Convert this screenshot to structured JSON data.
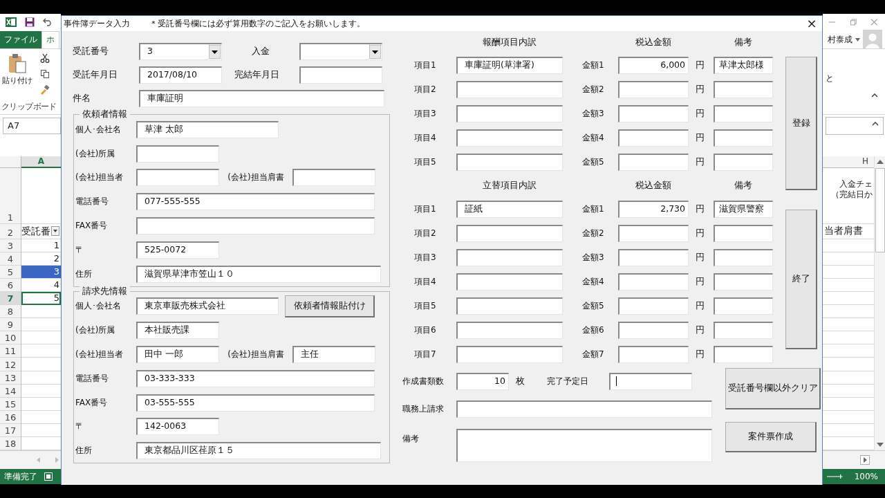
{
  "excel": {
    "file_tab": "ファイル",
    "home_tab": "ホ",
    "paste_label": "貼り付け",
    "group_label": "クリップボード",
    "name_box": "A7",
    "column_left": "A",
    "row1": "1",
    "header_row": {
      "num": "2",
      "cell": "受託番"
    },
    "rows": [
      {
        "num": "3",
        "cell": "1",
        "selected": false,
        "active": false
      },
      {
        "num": "4",
        "cell": "2",
        "selected": false,
        "active": false
      },
      {
        "num": "5",
        "cell": "3",
        "selected": true,
        "active": false
      },
      {
        "num": "6",
        "cell": "4",
        "selected": false,
        "active": false
      },
      {
        "num": "7",
        "cell": "5",
        "selected": false,
        "active": true
      },
      {
        "num": "8",
        "selected": false,
        "active": false
      },
      {
        "num": "9",
        "selected": false,
        "active": false
      },
      {
        "num": "10",
        "selected": false,
        "active": false
      },
      {
        "num": "11",
        "selected": false,
        "active": false
      },
      {
        "num": "12",
        "selected": false,
        "active": false
      },
      {
        "num": "13",
        "selected": false,
        "active": false
      },
      {
        "num": "14",
        "selected": false,
        "active": false
      },
      {
        "num": "15",
        "selected": false,
        "active": false
      },
      {
        "num": "16",
        "selected": false,
        "active": false
      },
      {
        "num": "17",
        "selected": false,
        "active": false
      },
      {
        "num": "18",
        "selected": false,
        "active": false
      }
    ],
    "status": "準備完了",
    "user": "村泰成",
    "ribbon_fragment": "と",
    "column_right": "H",
    "right_header_lines": [
      "入金チェ",
      "（完結日か"
    ],
    "right_row2": "当者肩書",
    "zoom": "100%"
  },
  "dialog": {
    "title": "事件簿データ入力",
    "notice": "＊受託番号欄には必ず算用数字のご記入をお願いします。",
    "close": "×"
  },
  "top_rows": [
    {
      "fields": [
        {
          "label": "受託番号",
          "kind": "combo",
          "value": "3"
        },
        {
          "label": "入金",
          "kind": "combo"
        }
      ]
    },
    {
      "fields": [
        {
          "label": "受託年月日",
          "kind": "text",
          "value": "2017/08/10"
        },
        {
          "label": "完結年月日",
          "kind": "text"
        }
      ]
    },
    {
      "fields": [
        {
          "label": "件名",
          "kind": "wide",
          "value": "車庫証明"
        }
      ]
    }
  ],
  "groups": [
    {
      "legend": "依頼者情報",
      "fields": [
        {
          "label": "個人･会社名",
          "kind": "name",
          "value": "草津 太郎"
        },
        {
          "label": "(会社)所属",
          "kind": "short"
        },
        {
          "label": "(会社)担当者",
          "kind": "short",
          "label2": "(会社)担当肩書"
        },
        {
          "label": "電話番号",
          "kind": "long",
          "value": "077-555-555"
        },
        {
          "label": "FAX番号",
          "kind": "long"
        },
        {
          "label": "〒",
          "kind": "short",
          "value": "525-0072"
        },
        {
          "label": "住所",
          "kind": "address",
          "value": "滋賀県草津市笠山１０"
        }
      ]
    },
    {
      "legend": "請求先情報",
      "button": "依頼者情報貼付け",
      "fields": [
        {
          "label": "個人･会社名",
          "kind": "name",
          "value": "東京車販売株式会社"
        },
        {
          "label": "(会社)所属",
          "kind": "short",
          "value": "本社販売課"
        },
        {
          "label": "(会社)担当者",
          "kind": "short",
          "value": "田中 一郎",
          "label2": "(会社)担当肩書",
          "value2": "主任"
        },
        {
          "label": "電話番号",
          "kind": "long",
          "value": "03-333-333"
        },
        {
          "label": "FAX番号",
          "kind": "long",
          "value": "03-555-555"
        },
        {
          "label": "〒",
          "kind": "short",
          "value": "142-0063"
        },
        {
          "label": "住所",
          "kind": "address",
          "value": "東京都品川区荏原１５"
        }
      ]
    }
  ],
  "sections": [
    {
      "title": "報酬項目内訳",
      "amount_title": "税込金額",
      "note_title": "備考",
      "rows": [
        {
          "label": "項目1",
          "value": "車庫証明(草津署)",
          "amount_label": "金額1",
          "amount": "6,000",
          "unit": "円",
          "note": "草津太郎様"
        },
        {
          "label": "項目2",
          "amount_label": "金額2",
          "unit": "円"
        },
        {
          "label": "項目3",
          "amount_label": "金額3",
          "unit": "円"
        },
        {
          "label": "項目4",
          "amount_label": "金額4",
          "unit": "円"
        },
        {
          "label": "項目5",
          "amount_label": "金額5",
          "unit": "円"
        }
      ]
    },
    {
      "title": "立替項目内訳",
      "amount_title": "税込金額",
      "note_title": "備考",
      "rows": [
        {
          "label": "項目1",
          "value": "証紙",
          "amount_label": "金額1",
          "amount": "2,730",
          "unit": "円",
          "note": "滋賀県警察"
        },
        {
          "label": "項目2",
          "amount_label": "金額2",
          "unit": "円"
        },
        {
          "label": "項目3",
          "amount_label": "金額3",
          "unit": "円"
        },
        {
          "label": "項目4",
          "amount_label": "金額4",
          "unit": "円"
        },
        {
          "label": "項目5",
          "amount_label": "金額5",
          "unit": "円"
        },
        {
          "label": "項目6",
          "amount_label": "金額6",
          "unit": "円"
        },
        {
          "label": "項目7",
          "amount_label": "金額7",
          "unit": "円"
        }
      ]
    }
  ],
  "side_buttons": [
    "登録",
    "終了"
  ],
  "bottom": {
    "count_label": "作成書類数",
    "count": "10",
    "count_unit": "枚",
    "due_label": "完了予定日",
    "due_focused": true,
    "request_label": "職務上請求",
    "memo_label": "備考"
  },
  "bottom_buttons": [
    "受託番号欄以外クリア",
    "案件票作成"
  ]
}
